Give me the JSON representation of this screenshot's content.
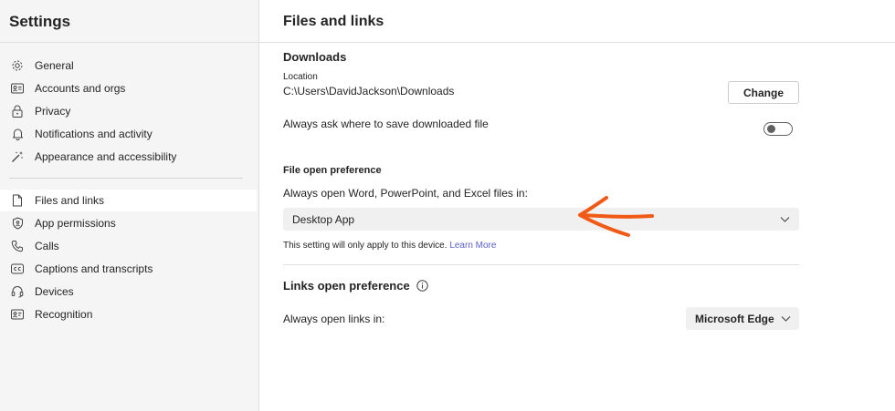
{
  "sidebar": {
    "title": "Settings",
    "items": [
      {
        "label": "General",
        "icon": "gear-icon"
      },
      {
        "label": "Accounts and orgs",
        "icon": "id-card-icon"
      },
      {
        "label": "Privacy",
        "icon": "lock-icon"
      },
      {
        "label": "Notifications and activity",
        "icon": "bell-icon"
      },
      {
        "label": "Appearance and accessibility",
        "icon": "magic-wand-icon"
      },
      {
        "label": "Files and links",
        "icon": "document-icon",
        "active": true
      },
      {
        "label": "App permissions",
        "icon": "shield-icon"
      },
      {
        "label": "Calls",
        "icon": "phone-icon"
      },
      {
        "label": "Captions and transcripts",
        "icon": "closed-captions-icon"
      },
      {
        "label": "Devices",
        "icon": "headset-icon"
      },
      {
        "label": "Recognition",
        "icon": "recognition-icon"
      }
    ]
  },
  "main": {
    "title": "Files and links",
    "downloads": {
      "title": "Downloads",
      "location_label": "Location",
      "location_value": "C:\\Users\\DavidJackson\\Downloads",
      "change_label": "Change",
      "always_ask_label": "Always ask where to save downloaded file",
      "always_ask_enabled": false
    },
    "file_open": {
      "title": "File open preference",
      "label": "Always open Word, PowerPoint, and Excel files in:",
      "selected": "Desktop App",
      "note": "This setting will only apply to this device.",
      "learn_more": "Learn More"
    },
    "links_open": {
      "title": "Links open preference",
      "label": "Always open links in:",
      "selected": "Microsoft Edge"
    }
  },
  "colors": {
    "sidebar_bg": "#f5f5f5",
    "link": "#5b5fc7",
    "annotation_arrow": "#f05a16"
  }
}
